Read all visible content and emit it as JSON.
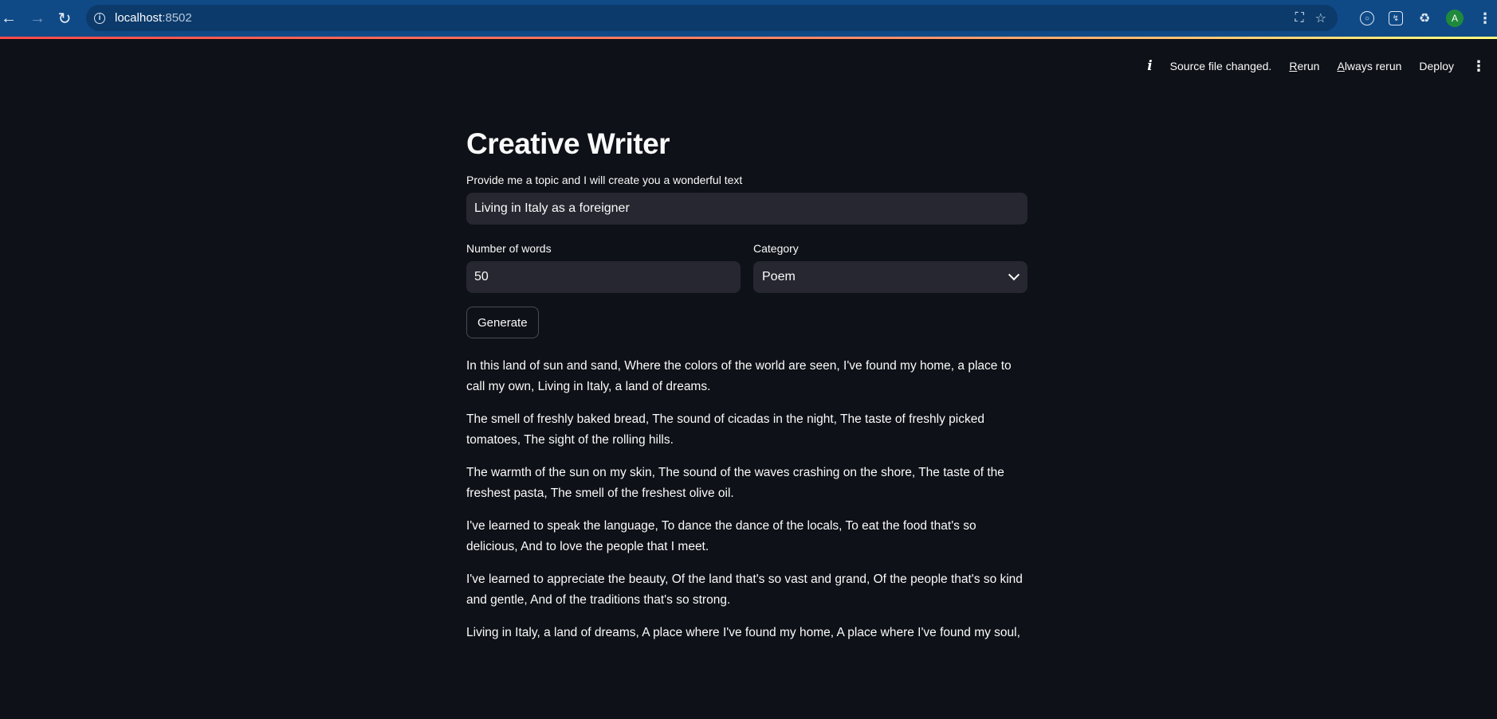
{
  "browser": {
    "url_host": "localhost",
    "url_port": ":8502",
    "profile_initial": "A"
  },
  "header": {
    "status_text": "Source file changed.",
    "rerun_first": "R",
    "rerun_rest": "erun",
    "always_first": "A",
    "always_rest": "lways rerun",
    "deploy_label": "Deploy"
  },
  "main": {
    "title": "Creative Writer",
    "topic_label": "Provide me a topic and I will create you a wonderful text",
    "topic_value": "Living in Italy as a foreigner",
    "words_label": "Number of words",
    "words_value": "50",
    "category_label": "Category",
    "category_value": "Poem",
    "generate_label": "Generate",
    "paragraphs": [
      "In this land of sun and sand, Where the colors of the world are seen, I've found my home, a place to call my own, Living in Italy, a land of dreams.",
      "The smell of freshly baked bread, The sound of cicadas in the night, The taste of freshly picked tomatoes, The sight of the rolling hills.",
      "The warmth of the sun on my skin, The sound of the waves crashing on the shore, The taste of the freshest pasta, The smell of the freshest olive oil.",
      "I've learned to speak the language, To dance the dance of the locals, To eat the food that's so delicious, And to love the people that I meet.",
      "I've learned to appreciate the beauty, Of the land that's so vast and grand, Of the people that's so kind and gentle, And of the traditions that's so strong.",
      "Living in Italy, a land of dreams, A place where I've found my home, A place where I've found my soul,"
    ]
  }
}
